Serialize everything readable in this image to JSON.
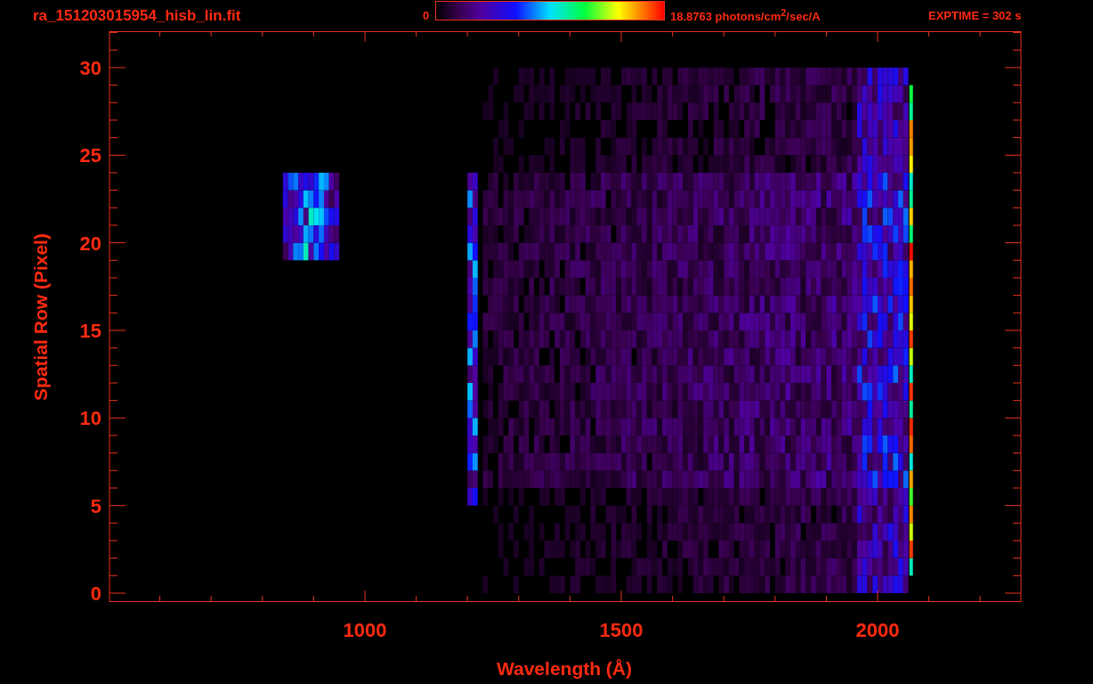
{
  "header": {
    "file_name": "ra_151203015954_hisb_lin.fit",
    "colorbar": {
      "min_label": "0",
      "max_label": "18.8763 photons/cm$^{2}$/sec/A"
    },
    "exposure": "EXPTIME = 302 s"
  },
  "plot": {
    "x_axis": {
      "title": "Wavelength (Å)",
      "tick_labels": [
        "1000",
        "1500",
        "2000"
      ]
    },
    "y_axis": {
      "title": "Spatial Row (Pixel)",
      "tick_labels": [
        "30",
        "25",
        "20",
        "15",
        "10",
        "5",
        "0"
      ]
    }
  }
}
